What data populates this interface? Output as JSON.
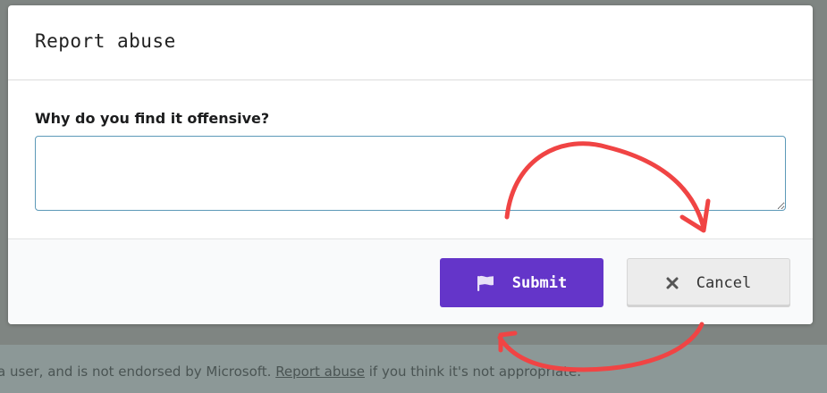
{
  "background": {
    "text_before": "a user, and is not endorsed by Microsoft. ",
    "link": "Report abuse",
    "text_after": " if you think it's not appropriate."
  },
  "modal": {
    "title": "Report abuse",
    "field_label": "Why do you find it offensive?",
    "field_value": "",
    "submit_label": "Submit",
    "cancel_label": "Cancel"
  },
  "colors": {
    "accent": "#6435c9",
    "annotation": "#f04444"
  },
  "icons": {
    "submit": "flag-icon",
    "cancel": "close-icon"
  }
}
